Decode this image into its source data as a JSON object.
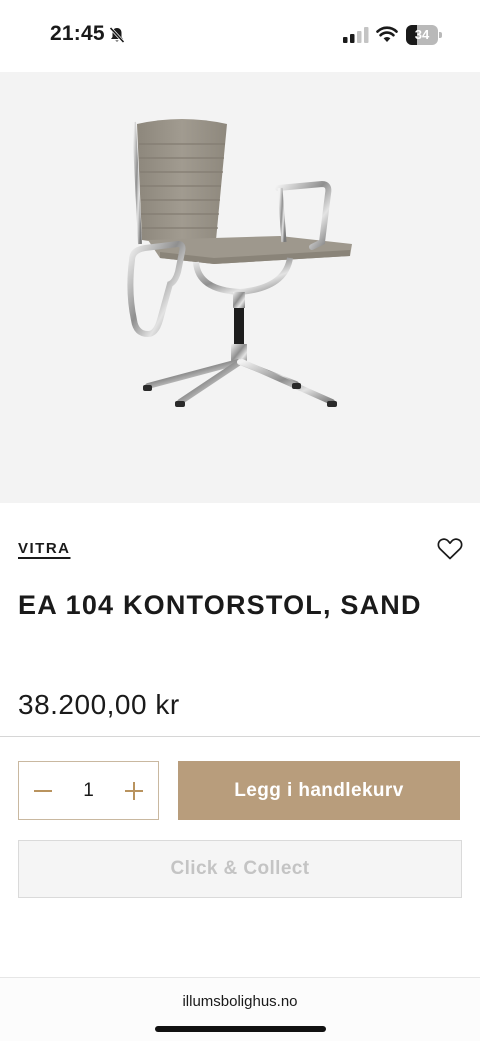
{
  "status_bar": {
    "time": "21:45",
    "battery": "34",
    "battery_level": 0.34
  },
  "product": {
    "brand": "VITRA",
    "title": "EA 104 KONTORSTOL, SAND",
    "price": "38.200,00 kr",
    "image_icon": "chair-image"
  },
  "cart": {
    "quantity": "1",
    "add_label": "Legg i handlekurv",
    "click_collect_label": "Click & Collect"
  },
  "browser": {
    "url": "illumsbolighus.no"
  },
  "colors": {
    "accent": "#b89d7c",
    "qty_border": "#c9b8a0",
    "hero_bg": "#f3f3f3"
  }
}
